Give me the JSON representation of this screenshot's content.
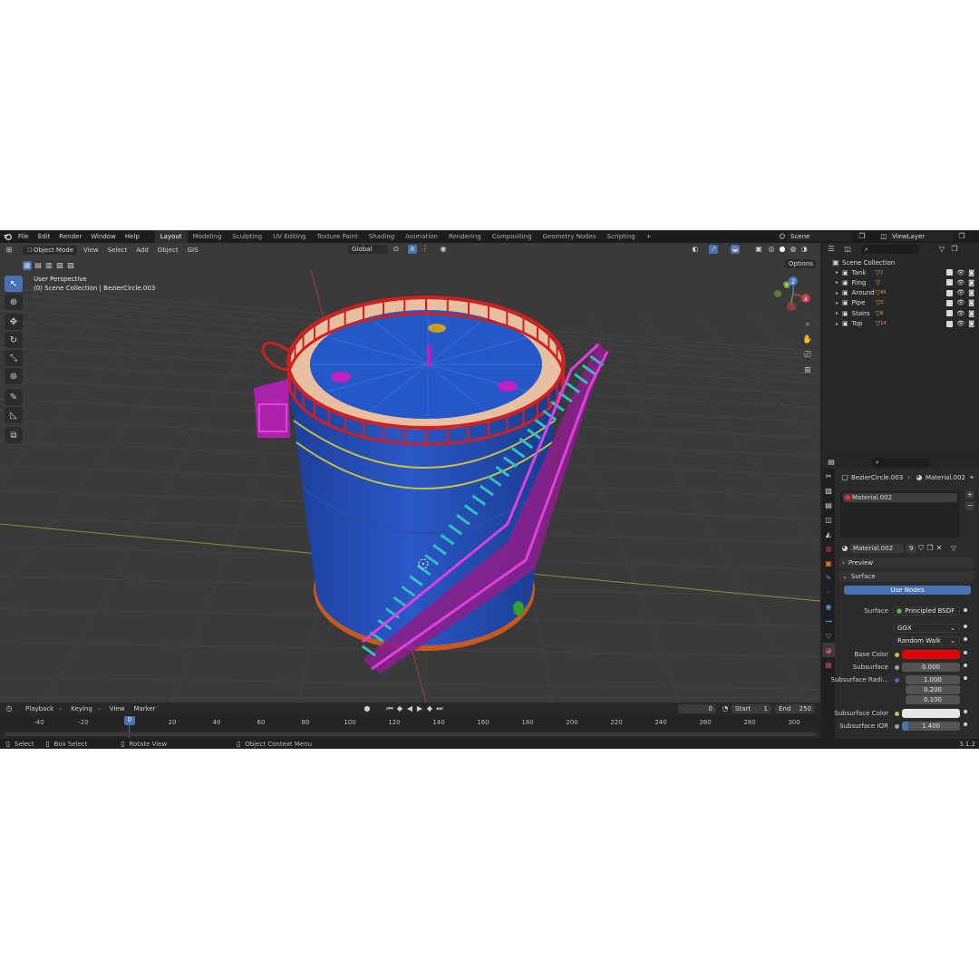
{
  "topbar": {
    "menus": [
      "File",
      "Edit",
      "Render",
      "Window",
      "Help"
    ],
    "workspaces": [
      "Layout",
      "Modeling",
      "Sculpting",
      "UV Editing",
      "Texture Paint",
      "Shading",
      "Animation",
      "Rendering",
      "Compositing",
      "Geometry Nodes",
      "Scripting"
    ],
    "active_workspace": "Layout",
    "add_tab": "+",
    "scene": "Scene",
    "view_layer": "ViewLayer"
  },
  "viewport": {
    "mode": "Object Mode",
    "menus": [
      "View",
      "Select",
      "Add",
      "Object",
      "GIS"
    ],
    "orientation": "Global",
    "options": "Options",
    "info_line1": "User Perspective",
    "info_line2": "(0) Scene Collection | BezierCircle.003",
    "axis_x": "X",
    "axis_y": "Y",
    "axis_z": "Z"
  },
  "timeline": {
    "menus": [
      "Playback",
      "Keying",
      "View",
      "Marker"
    ],
    "current_frame": "0",
    "start_label": "Start",
    "start": "1",
    "end_label": "End",
    "end": "250",
    "ticks": [
      "-40",
      "-20",
      "0",
      "20",
      "40",
      "60",
      "80",
      "100",
      "120",
      "140",
      "160",
      "180",
      "200",
      "220",
      "240",
      "260",
      "280",
      "300"
    ]
  },
  "statusbar": {
    "select": "Select",
    "box_select": "Box Select",
    "rotate_view": "Rotate View",
    "context_menu": "Object Context Menu",
    "version": "3.1.2"
  },
  "outliner": {
    "root": "Scene Collection",
    "items": [
      {
        "name": "Tank",
        "count": "2"
      },
      {
        "name": "Ring",
        "count": ""
      },
      {
        "name": "Around",
        "count": "45"
      },
      {
        "name": "Pipe",
        "count": "3"
      },
      {
        "name": "Stairs",
        "count": "8"
      },
      {
        "name": "Top",
        "count": "14"
      }
    ]
  },
  "properties": {
    "breadcrumb_object": "BezierCircle.003",
    "breadcrumb_material": "Material.002",
    "slot_name": "Material.002",
    "material_name": "Material.002",
    "users": "9",
    "panel_preview": "Preview",
    "panel_surface": "Surface",
    "use_nodes": "Use Nodes",
    "surface_label": "Surface",
    "surface_value": "Principled BSDF",
    "distribution": "GGX",
    "subsurface_method": "Random Walk",
    "base_color_label": "Base Color",
    "base_color": "#e00000",
    "subsurface_label": "Subsurface",
    "subsurface_value": "0.000",
    "subsurface_radius_label": "Subsurface Radi...",
    "radius_values": [
      "1.000",
      "0.200",
      "0.100"
    ],
    "subsurface_color_label": "Subsurface Color",
    "subsurface_color": "#e6e6e6",
    "subsurface_ior_label": "Subsurface IOR",
    "subsurface_ior_value": "1.400"
  }
}
